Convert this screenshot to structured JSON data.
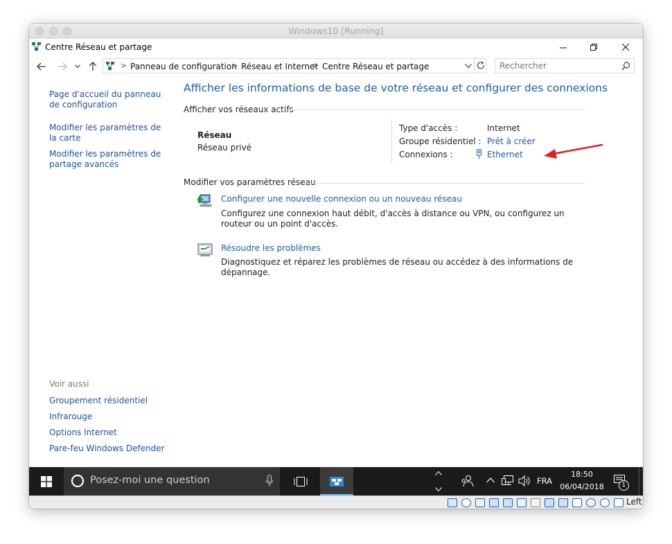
{
  "vm_window": {
    "title": "Windows10 [Running]"
  },
  "window": {
    "title": "Centre Réseau et partage"
  },
  "address_bar": {
    "crumbs": [
      "Panneau de configuration",
      "Réseau et Internet",
      "Centre Réseau et partage"
    ],
    "search_placeholder": "Rechercher"
  },
  "sidebar": {
    "links": [
      {
        "label": "Page d'accueil du panneau de configuration"
      },
      {
        "label": "Modifier les paramètres de la carte"
      },
      {
        "label": "Modifier les paramètres de partage avancés"
      }
    ],
    "see_also_title": "Voir aussi",
    "see_also": [
      {
        "label": "Groupement résidentiel"
      },
      {
        "label": "Infrarouge"
      },
      {
        "label": "Options Internet"
      },
      {
        "label": "Pare-feu Windows Defender"
      }
    ]
  },
  "main": {
    "title": "Afficher les informations de base de votre réseau et configurer des connexions",
    "active_networks_heading": "Afficher vos réseaux actifs",
    "network": {
      "name": "Réseau",
      "profile": "Réseau privé",
      "access_type_label": "Type d'accès :",
      "access_type_value": "Internet",
      "homegroup_label": "Groupe résidentiel :",
      "homegroup_value": "Prêt à créer",
      "connections_label": "Connexions :",
      "connections_value": "Ethernet"
    },
    "change_settings_heading": "Modifier vos paramètres réseau",
    "tasks": [
      {
        "title": "Configurer une nouvelle connexion ou un nouveau réseau",
        "description": "Configurez une connexion haut débit, d'accès à distance ou VPN, ou configurez un routeur ou un point d'accès."
      },
      {
        "title": "Résoudre les problèmes",
        "description": "Diagnostiquez et réparez les problèmes de réseau ou accédez à des informations de dépannage."
      }
    ]
  },
  "taskbar": {
    "search_placeholder": "Posez-moi une question",
    "language": "FRA",
    "time": "18:50",
    "date": "06/04/2018",
    "notification_count": "1"
  },
  "vbox_status": {
    "host_key": "Left ⌘"
  },
  "colors": {
    "link": "#1e5aa7",
    "taskbar": "#1b1b1b",
    "annotation_arrow": "#e02020"
  }
}
